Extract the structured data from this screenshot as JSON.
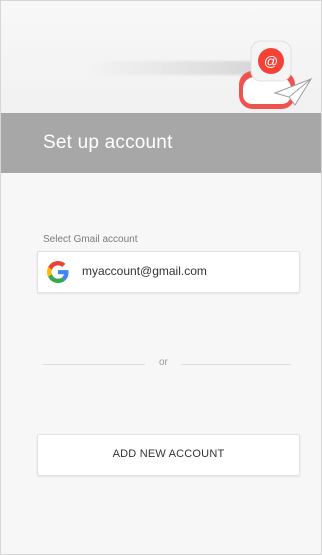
{
  "header": {
    "title": "Set up account"
  },
  "hero": {
    "icon": "email-app-icon"
  },
  "gmail": {
    "section_label": "Select Gmail account",
    "accounts": [
      {
        "provider_icon": "google-g-icon",
        "email": "myaccount@gmail.com"
      }
    ]
  },
  "divider": {
    "text": "or"
  },
  "actions": {
    "add_account_label": "ADD NEW ACCOUNT"
  },
  "colors": {
    "header_bg": "#a7a7a7",
    "page_bg": "#f7f7f7",
    "accent_red": "#e53935",
    "google_blue": "#4285F4",
    "google_red": "#EA4335",
    "google_yellow": "#FBBC05",
    "google_green": "#34A853"
  }
}
